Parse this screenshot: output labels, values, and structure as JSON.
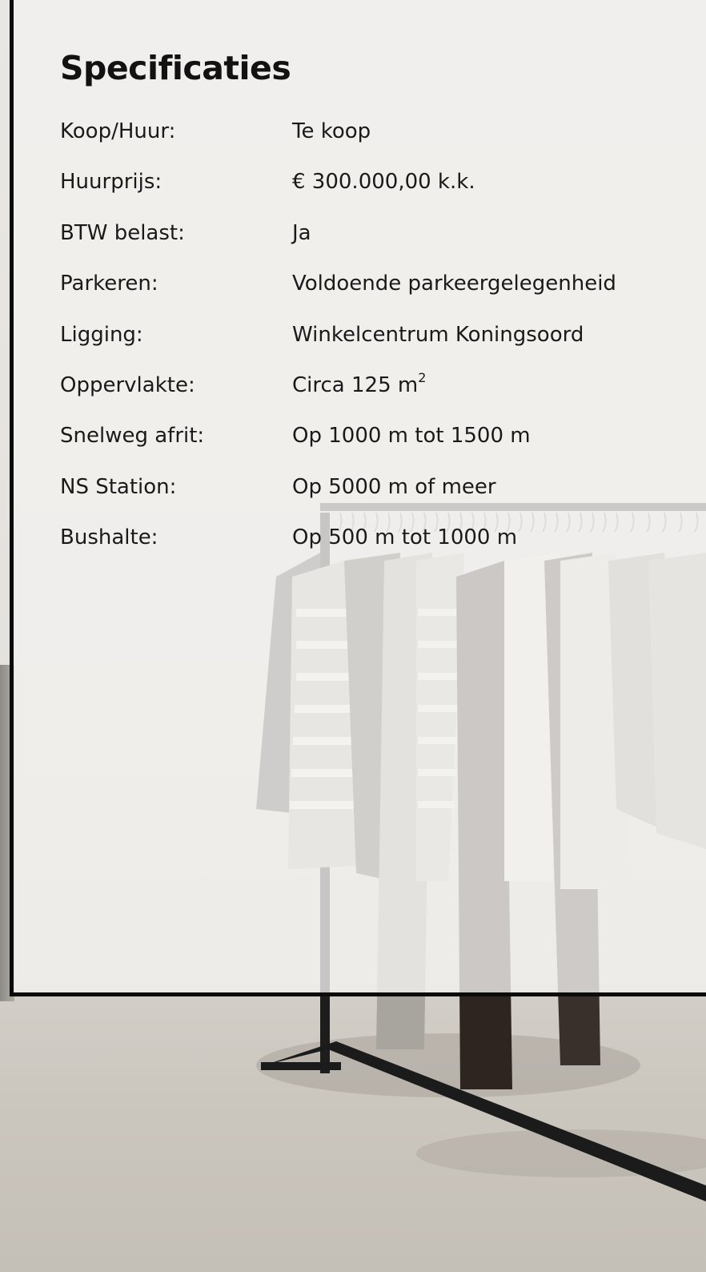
{
  "title": "Specificaties",
  "rows": [
    {
      "label": "Koop/Huur:",
      "value": "Te koop"
    },
    {
      "label": "Huurprijs:",
      "value": "€ 300.000,00 k.k."
    },
    {
      "label": "BTW belast:",
      "value": "Ja"
    },
    {
      "label": "Parkeren:",
      "value": "Voldoende parkeergelegenheid"
    },
    {
      "label": "Ligging:",
      "value": "Winkelcentrum Koningsoord"
    },
    {
      "label": "Oppervlakte:",
      "value": "Circa 125 m",
      "superscript": "2"
    },
    {
      "label": "Snelweg afrit:",
      "value": "Op 1000 m tot 1500 m"
    },
    {
      "label": "NS Station:",
      "value": "Op 5000 m of meer"
    },
    {
      "label": "Bushalte:",
      "value": "Op 500 m tot 1000 m"
    }
  ],
  "colors": {
    "card_border": "#0b0b0b",
    "text": "#1a1a1a",
    "card_background": "rgba(242,241,239,0.80)"
  },
  "background_image": "clothing rack with garments in a bright retail space"
}
